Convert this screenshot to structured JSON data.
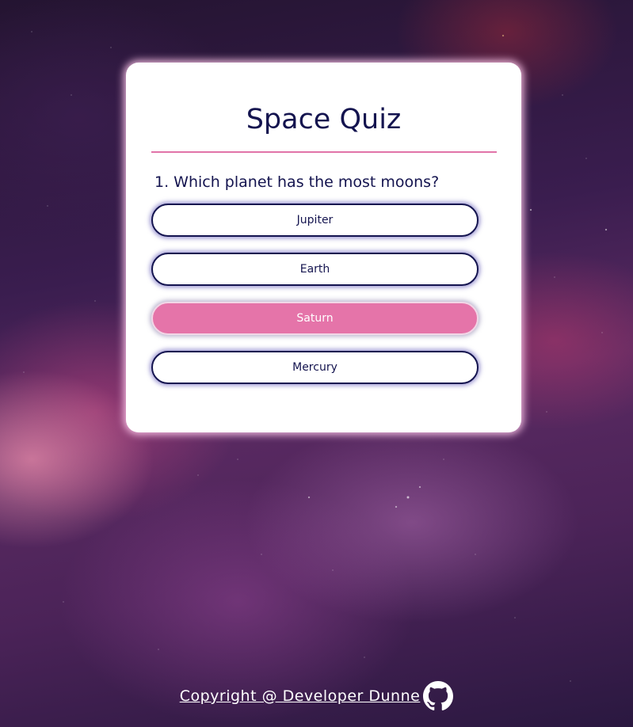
{
  "app": {
    "title": "Space Quiz"
  },
  "quiz": {
    "question_number": "1.",
    "question": "1. Which planet has the most moons?",
    "answers": [
      {
        "label": "Jupiter",
        "selected": false
      },
      {
        "label": "Earth",
        "selected": false
      },
      {
        "label": "Saturn",
        "selected": true
      },
      {
        "label": "Mercury",
        "selected": false
      }
    ]
  },
  "footer": {
    "copyright_label": "Copyright @ Developer Dunne",
    "icon": "github-icon"
  },
  "colors": {
    "primary_text": "#14144f",
    "accent_pink": "#e574a9",
    "card_background": "#ffffff"
  }
}
